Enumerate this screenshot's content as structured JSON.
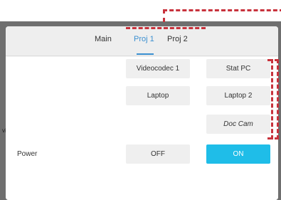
{
  "tabs": [
    {
      "label": "Main",
      "active": false
    },
    {
      "label": "Proj 1",
      "active": true
    },
    {
      "label": "Proj 2",
      "active": false
    }
  ],
  "sources": {
    "videocodec1": "Videocodec 1",
    "stat_pc": "Stat PC",
    "laptop": "Laptop",
    "laptop2": "Laptop 2",
    "doc_cam": "Doc Cam"
  },
  "power": {
    "label": "Power",
    "off": "OFF",
    "on": "ON",
    "state": "on"
  },
  "background_fragment": "vi",
  "colors": {
    "accent": "#3a8fd0",
    "on_button": "#1fbde8",
    "annotation": "#c8323c"
  }
}
